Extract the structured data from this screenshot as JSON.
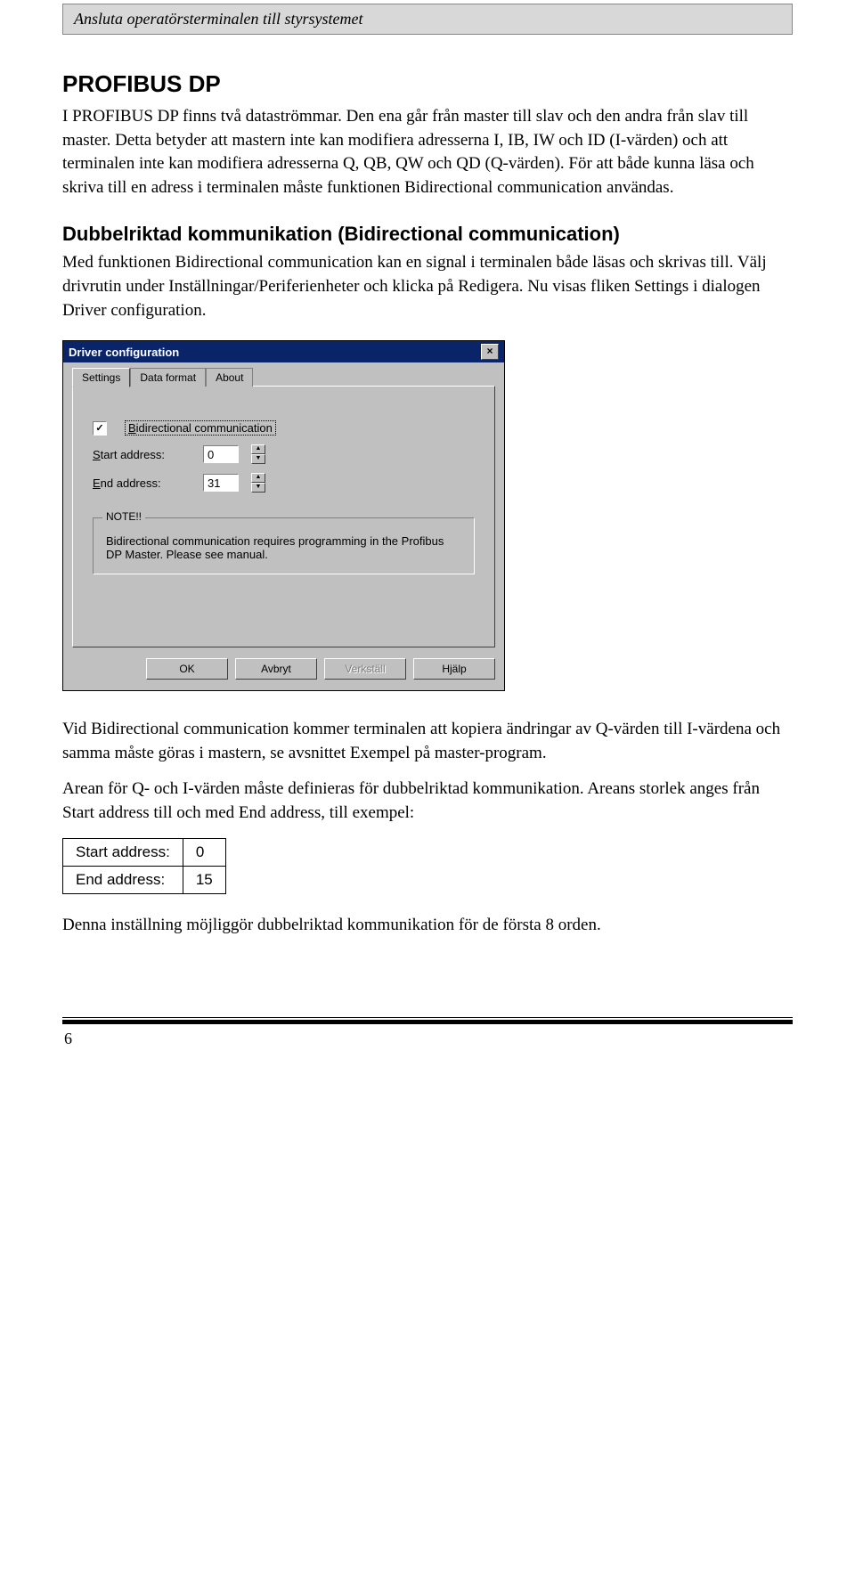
{
  "header": "Ansluta operatörsterminalen till styrsystemet",
  "section_title": "PROFIBUS DP",
  "para1": "I PROFIBUS DP finns två dataströmmar. Den ena går från master till slav och den andra från slav till master. Detta betyder att mastern inte kan modifiera adresserna I, IB, IW och ID (I-värden) och att terminalen inte kan modifiera adresserna Q, QB, QW och QD (Q-värden). För att både kunna läsa och skriva till en adress i terminalen måste funktionen Bidirectional communication användas.",
  "subsection_title": "Dubbelriktad kommunikation (Bidirectional communication)",
  "para2": "Med funktionen Bidirectional communication kan en signal i terminalen både läsas och skrivas till. Välj drivrutin under Inställningar/Periferienheter och klicka på Redigera. Nu visas fliken Settings i dialogen Driver configuration.",
  "dialog": {
    "title": "Driver configuration",
    "tabs": [
      "Settings",
      "Data format",
      "About"
    ],
    "bidi_label": "Bidirectional communication",
    "start_label": "Start address:",
    "start_val": "0",
    "end_label": "End address:",
    "end_val": "31",
    "note_title": "NOTE!!",
    "note_text": "Bidirectional communication requires programming in the Profibus DP Master. Please see manual.",
    "buttons": {
      "ok": "OK",
      "cancel": "Avbryt",
      "apply": "Verkställ",
      "help": "Hjälp"
    }
  },
  "para3": "Vid Bidirectional communication kommer terminalen att kopiera ändringar av Q-värden till I-värdena och samma måste göras i mastern, se avsnittet Exempel på master-program.",
  "para4": "Arean för Q- och I-värden måste definieras för dubbelriktad kommunikation. Areans storlek anges från Start address till och med End address, till exempel:",
  "table": {
    "rows": [
      {
        "label": "Start address:",
        "val": "0"
      },
      {
        "label": "End address:",
        "val": "15"
      }
    ]
  },
  "para5": "Denna inställning möjliggör dubbelriktad kommunikation för de första 8 orden.",
  "page_number": "6"
}
